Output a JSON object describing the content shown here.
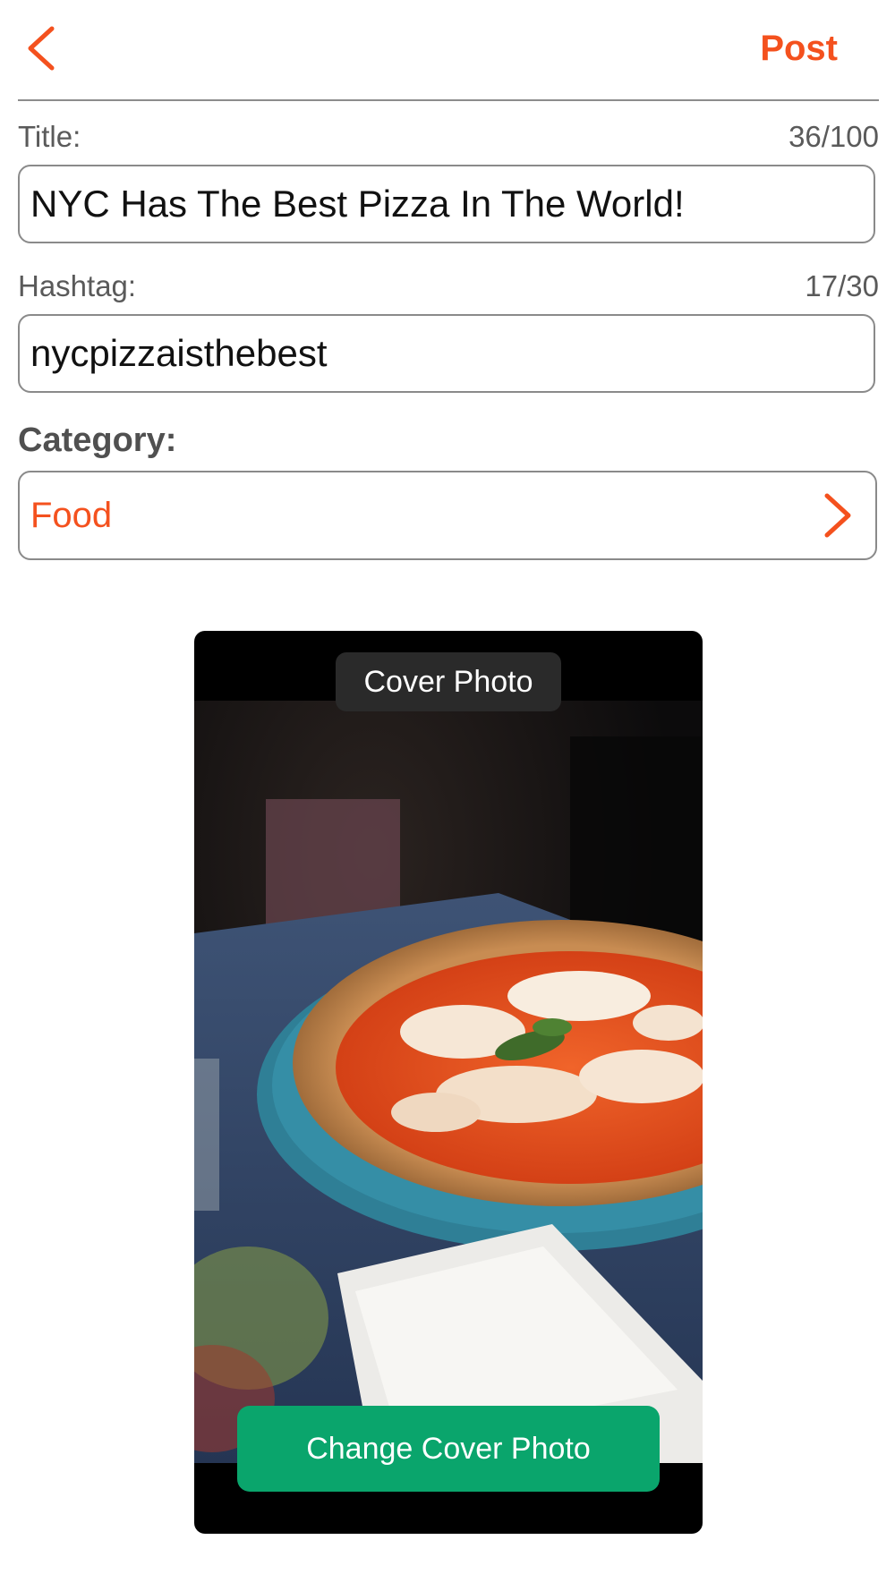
{
  "header": {
    "back_icon": "chevron-left-icon",
    "post_label": "Post"
  },
  "form": {
    "title": {
      "label": "Title:",
      "count": "36/100",
      "value": "NYC Has The Best Pizza In The World!"
    },
    "hashtag": {
      "label": "Hashtag:",
      "count": "17/30",
      "value": "nycpizzaisthebest"
    },
    "category": {
      "label": "Category:",
      "value": "Food",
      "icon": "chevron-right-icon"
    }
  },
  "cover": {
    "tag_label": "Cover Photo",
    "change_button_label": "Change Cover Photo",
    "image": "pizza-photo"
  },
  "colors": {
    "accent": "#f4511e",
    "button_green": "#0aa56c",
    "border": "#8a8a8a",
    "label_gray": "#5a5a5a"
  }
}
